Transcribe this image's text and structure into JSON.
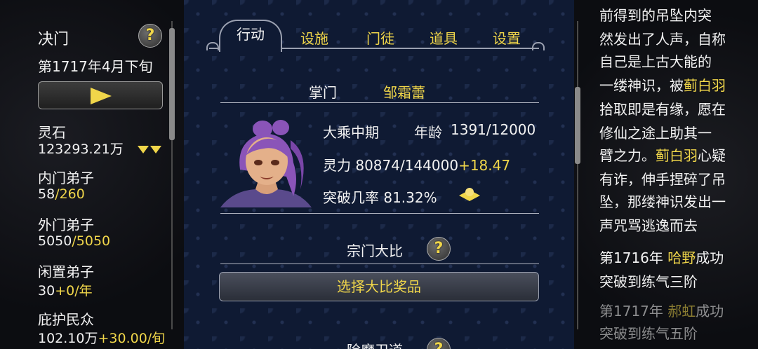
{
  "left": {
    "title": "决门",
    "date": "第1717年4月下旬",
    "help": "?",
    "stats": [
      {
        "label": "灵石",
        "value": "123293.21万"
      },
      {
        "label": "内门弟子",
        "value": "58",
        "value_extra": "/260"
      },
      {
        "label": "外门弟子",
        "value": "5050",
        "value_extra": "/5050"
      },
      {
        "label": "闲置弟子",
        "value": "30",
        "value_extra": "+0/年"
      },
      {
        "label": "庇护民众",
        "value": "102.10万",
        "value_extra": "+30.00/旬"
      }
    ]
  },
  "tabs": [
    "行动",
    "设施",
    "门徒",
    "道具",
    "设置"
  ],
  "sect": {
    "leader_label": "掌门",
    "leader_name": "邹霜蕾",
    "realm": "大乘中期",
    "age_label": "年龄",
    "age_value": "1391/12000",
    "spirit_label": "灵力",
    "spirit_value": "80874/144000",
    "spirit_gain": "+18.47",
    "breakthrough_label": "突破几率",
    "breakthrough_value": "81.32%",
    "competition_label": "宗门大比",
    "select_reward_button": "选择大比奖品",
    "next_section": "除魔卫道"
  },
  "log": [
    [
      {
        "t": "前得到的吊坠内突"
      }
    ],
    [
      {
        "t": "然发出了人声，自称"
      }
    ],
    [
      {
        "t": "自己是上古大能的"
      }
    ],
    [
      {
        "t": "一缕神识，被"
      },
      {
        "t": "蓟白羽",
        "gold": true
      }
    ],
    [
      {
        "t": "拾取即是有缘，愿在"
      }
    ],
    [
      {
        "t": "修仙之途上助其一"
      }
    ],
    [
      {
        "t": "臂之力。"
      },
      {
        "t": "蓟白羽",
        "gold": true
      },
      {
        "t": "心疑"
      }
    ],
    [
      {
        "t": "有诈，伸手捏碎了吊"
      }
    ],
    [
      {
        "t": "坠，那缕神识发出一"
      }
    ],
    [
      {
        "t": "声咒骂逃逸而去"
      }
    ],
    [
      {
        "t": "第1716年 "
      },
      {
        "t": "哈野",
        "gold": true
      },
      {
        "t": "成功"
      }
    ],
    [
      {
        "t": "突破到练气三阶"
      }
    ],
    [
      {
        "t": "第1717年 "
      },
      {
        "t": "郝虹",
        "gold": true
      },
      {
        "t": "成功",
        "faded": true
      }
    ],
    [
      {
        "t": "突破到练气五阶",
        "faded": true
      }
    ]
  ],
  "colors": {
    "gold": "#f0d64a",
    "panel_bg": "#0f1a33"
  }
}
